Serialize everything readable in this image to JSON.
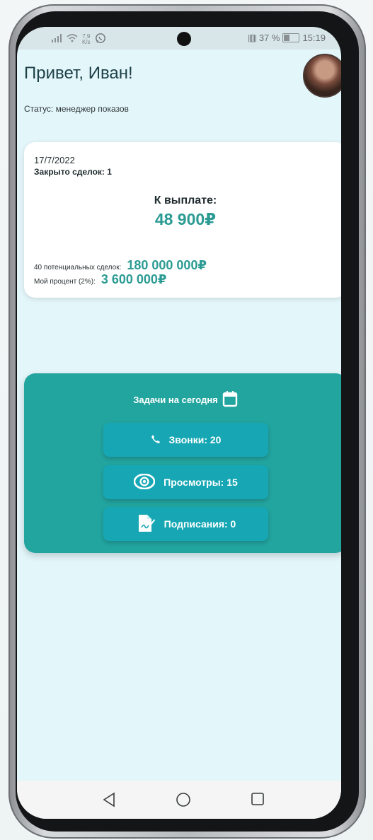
{
  "status_bar": {
    "network_speed_value": "7,9",
    "network_speed_unit": "K/s",
    "vibrate": "||[]||",
    "battery_percent": "37 %",
    "time": "15:19"
  },
  "header": {
    "greeting": "Привет, Иван!",
    "status_text": "Статус: менеджер показов"
  },
  "summary": {
    "date": "17/7/2022",
    "closed_deals": "Закрыто сделок: 1",
    "payout_label": "К выплате:",
    "payout_value": "48 900₽",
    "potential_label": "40 потенциальных сделок:",
    "potential_value": "180 000 000₽",
    "percent_label": "Мой процент (2%):",
    "percent_value": "3 600 000₽"
  },
  "tasks": {
    "title": "Задачи на сегодня",
    "calls": "Звонки: 20",
    "views": "Просмотры: 15",
    "signings": "Подписания: 0"
  },
  "icons": {
    "status": [
      "signal-icon",
      "wifi-icon",
      "whatsapp-icon",
      "camera-hole",
      "vibrate-icon",
      "battery-icon"
    ],
    "tasks": [
      "calendar-icon",
      "phone-icon",
      "eye-icon",
      "document-sign-icon"
    ],
    "nav": [
      "back-icon",
      "home-icon",
      "recent-apps-icon"
    ]
  },
  "colors": {
    "background": "#e3f6fa",
    "accent": "#22a49f",
    "button": "#17a7b4",
    "text": "#1d3f47"
  }
}
